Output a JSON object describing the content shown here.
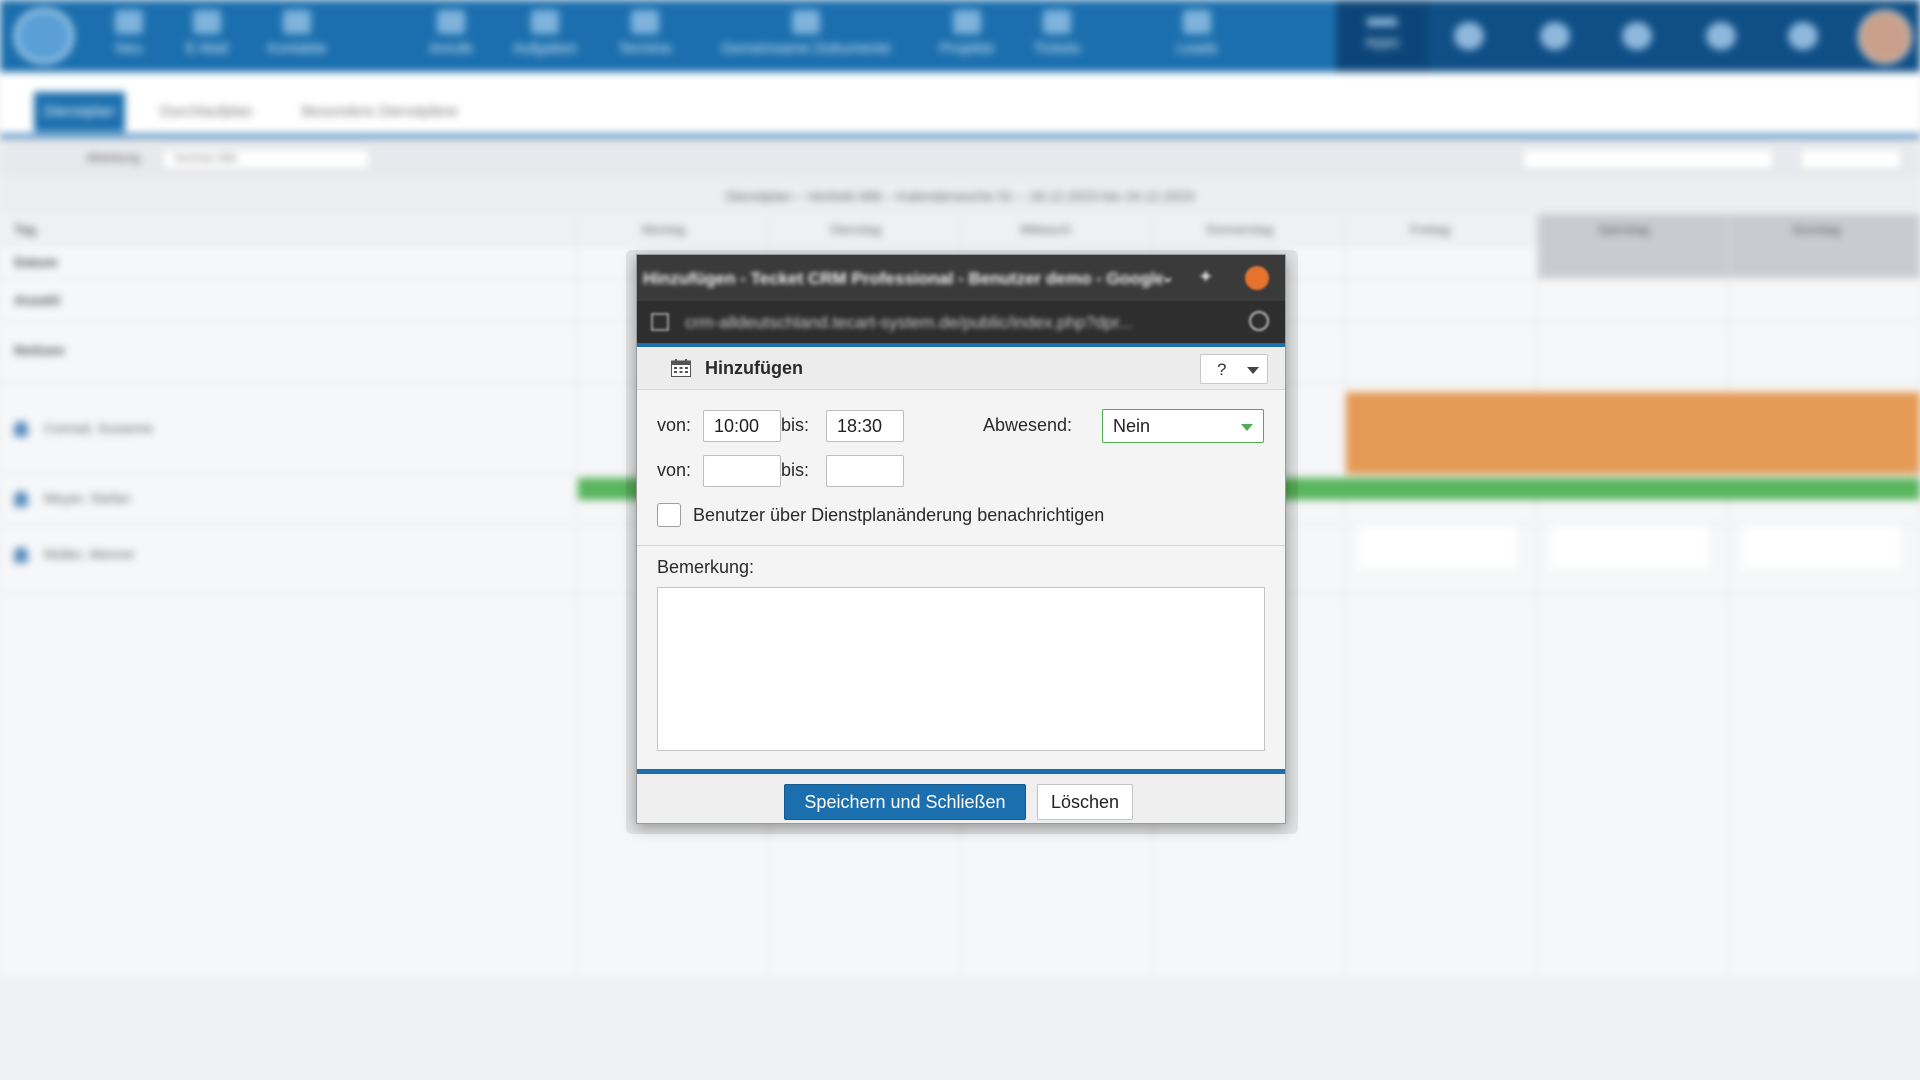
{
  "background": {
    "nav": [
      "Neu",
      "E-Mail",
      "Kontakte",
      "Anrufe",
      "Aufgaben",
      "Termine",
      "Gemeinsame Dokumente",
      "Projekte",
      "Tickets",
      "Leads"
    ],
    "apps_label": "Apps",
    "tabs": [
      "Dienstplan",
      "Durchlaufplan",
      "Besondere Dienstpläne"
    ],
    "filter_label": "Abteilung",
    "filter_value": "Vertrieb Mitt",
    "subtitle": "Dienstplan – Vertrieb Mitt – Kalenderwoche 51 – 18.12.2023 bis 24.12.2023",
    "day_headers": [
      "Tag",
      "Montag",
      "Dienstag",
      "Mittwoch",
      "Donnerstag",
      "Freitag",
      "Samstag",
      "Sonntag"
    ],
    "row_labels": [
      "Datum",
      "Anzahl",
      "Notizen"
    ],
    "people": [
      "Conrad, Susanne",
      "Meyer, Stefan",
      "Müller, Werner"
    ]
  },
  "window": {
    "title": "Hinzufügen - Tecket CRM Professional - Benutzer demo - Google Chrome",
    "url": "crm-alldeutschland.tecart-system.de/public/index.php?dpr..."
  },
  "dialog": {
    "title": "Hinzufügen",
    "help_label": "?",
    "row1": {
      "von_label": "von:",
      "von_value": "10:00",
      "bis_label": "bis:",
      "bis_value": "18:30"
    },
    "row2": {
      "von_label": "von:",
      "von_value": "",
      "bis_label": "bis:",
      "bis_value": ""
    },
    "abwesend_label": "Abwesend:",
    "abwesend_value": "Nein",
    "notify_label": "Benutzer über Dienstplanänderung benachrichtigen",
    "bemerkung_label": "Bemerkung:",
    "bemerkung_value": "",
    "save_label": "Speichern und Schließen",
    "delete_label": "Löschen"
  },
  "colors": {
    "brand": "#1b6fae",
    "accent_green": "#4caf50",
    "vacation_orange": "#e59a55"
  }
}
